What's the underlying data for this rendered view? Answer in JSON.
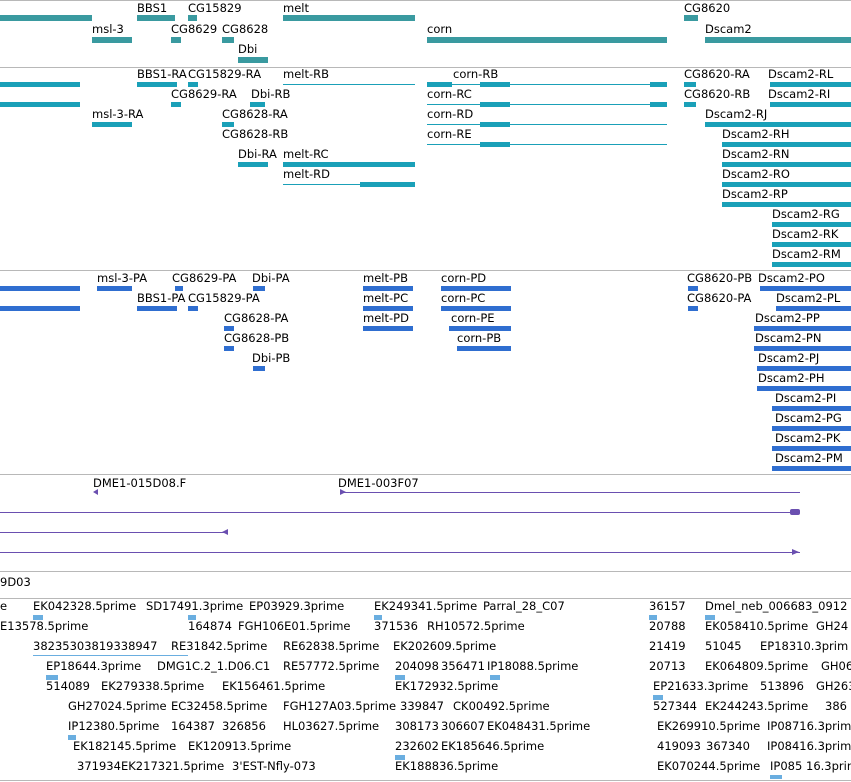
{
  "colors": {
    "gene": "#3a9aa0",
    "transcript": "#1aa0b8",
    "protein": "#2f6ed0",
    "clone": "#6a4fb0",
    "est": "#6aaee0",
    "separator": "#b8b8b8"
  },
  "tracks": {
    "genes": [
      "BBS1",
      "CG15829",
      "melt",
      "CG8620",
      "msl-3",
      "CG8629",
      "CG8628",
      "corn",
      "Dscam2",
      "Dbi"
    ],
    "transcripts": [
      "BBS1-RA",
      "CG15829-RA",
      "melt-RB",
      "corn-RB",
      "CG8620-RA",
      "Dscam2-RL",
      "CG8629-RA",
      "Dbi-RB",
      "corn-RC",
      "CG8620-RB",
      "Dscam2-RI",
      "msl-3-RA",
      "CG8628-RA",
      "corn-RD",
      "Dscam2-RJ",
      "CG8628-RB",
      "corn-RE",
      "Dscam2-RH",
      "Dbi-RA",
      "melt-RC",
      "Dscam2-RN",
      "melt-RD",
      "Dscam2-RO",
      "Dscam2-RP",
      "Dscam2-RG",
      "Dscam2-RK",
      "Dscam2-RM"
    ],
    "proteins": [
      "msl-3-PA",
      "CG8629-PA",
      "Dbi-PA",
      "melt-PB",
      "corn-PD",
      "CG8620-PB",
      "Dscam2-PO",
      "BBS1-PA",
      "CG15829-PA",
      "melt-PC",
      "corn-PC",
      "CG8620-PA",
      "Dscam2-PL",
      "CG8628-PA",
      "melt-PD",
      "corn-PE",
      "Dscam2-PP",
      "CG8628-PB",
      "corn-PB",
      "Dscam2-PN",
      "Dbi-PB",
      "Dscam2-PJ",
      "Dscam2-PH",
      "Dscam2-PI",
      "Dscam2-PG",
      "Dscam2-PK",
      "Dscam2-PM"
    ],
    "clones": [
      "DME1-015D08.F",
      "DME1-003F07"
    ],
    "clone_partial": "9D03",
    "ests": [
      "e",
      "EK042328.5prime",
      "SD17491.3prime",
      "EP03929.3prime",
      "EK249341.5prime",
      "Parral_28_C07",
      "36157",
      "Dmel_neb_006683_0912",
      "E13578.5prime",
      "164874",
      "FGH106E01.5prime",
      "371536",
      "RH10572.5prime",
      "20788",
      "EK058410.5prime",
      "GH24",
      "38235303819338947",
      "RE31842.5prime",
      "RE62838.5prime",
      "EK202609.5prime",
      "21419",
      "51045",
      "EP18310.3prim",
      "EP18644.3prime",
      "DMG1C.2_1.D06.C1",
      "RE57772.5prime",
      "204098",
      "356471",
      "IP18088.5prime",
      "20713",
      "EK064809.5prime",
      "GH06",
      "514089",
      "EK279338.5prime",
      "EK156461.5prime",
      "EK172932.5prime",
      "EP21633.3prime",
      "513896",
      "GH263",
      "GH27024.5prime",
      "EC32458.5prime",
      "FGH127A03.5prime",
      "339847",
      "CK00492.5prime",
      "527344",
      "EK244243.5prime",
      "386",
      "IP12380.5prime",
      "164387",
      "326856",
      "HL03627.5prime",
      "308173",
      "306607",
      "EK048431.5prime",
      "EK269910.5prime",
      "IP08716.3prim",
      "EK182145.5prime",
      "EK120913.5prime",
      "232602",
      "EK185646.5prime",
      "419093",
      "367340",
      "IP08416.3prim",
      "371934",
      "EK217321.5prime",
      "3'EST-Nfly-073",
      "EK188836.5prime",
      "EK070244.5prime",
      "IP085",
      "16.3prim"
    ]
  }
}
